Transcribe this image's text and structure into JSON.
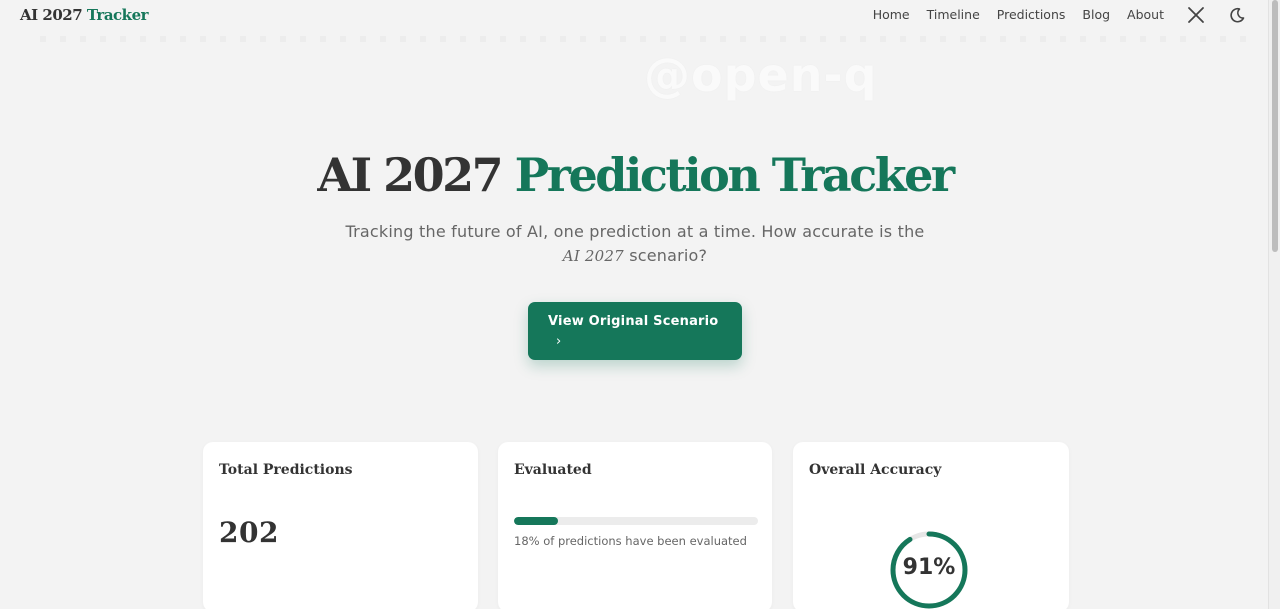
{
  "nav": {
    "brand_main": "AI 2027",
    "brand_accent": "Tracker",
    "links": [
      "Home",
      "Timeline",
      "Predictions",
      "Blog",
      "About"
    ],
    "icons": [
      "x-logo-icon",
      "moon-icon"
    ]
  },
  "watermark": "@open-q",
  "hero": {
    "title_main": "AI 2027",
    "title_accent": "Prediction Tracker",
    "subtitle_part1": "Tracking the future of AI, one prediction at a time. How accurate is the",
    "subtitle_em": "AI 2027",
    "subtitle_part2": "scenario?",
    "cta_label": "View Original Scenario",
    "cta_chevron": "›"
  },
  "stats": {
    "total": {
      "title": "Total Predictions",
      "value": "202"
    },
    "evaluated": {
      "title": "Evaluated",
      "percent": 18,
      "note": "18% of predictions have been evaluated"
    },
    "accuracy": {
      "title": "Overall Accuracy",
      "percent": 91,
      "label": "91%"
    }
  },
  "colors": {
    "accent": "#15775a",
    "background": "#f3f3f3",
    "text": "#333333",
    "muted": "#666666"
  }
}
